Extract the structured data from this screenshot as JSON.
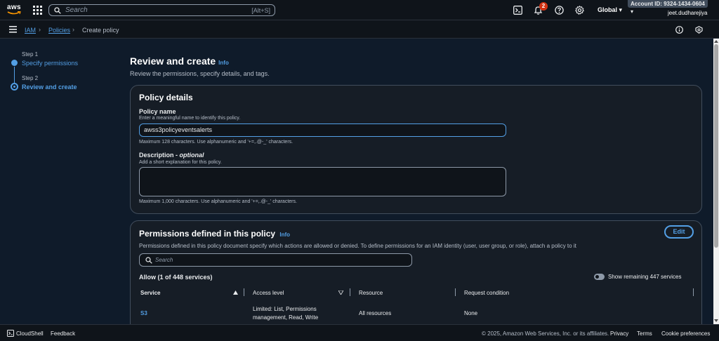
{
  "topnav": {
    "logo_text": "aws",
    "search_placeholder": "Search",
    "search_shortcut": "[Alt+S]",
    "notifications_count": "2",
    "region": "Global ▾",
    "account": "Account ID: 9324-1434-0604 ▾",
    "username": "jeet.dudharejiya"
  },
  "breadcrumb": {
    "items": [
      "IAM",
      "Policies",
      "Create policy"
    ]
  },
  "steps": [
    {
      "label": "Step 1",
      "title": "Specify permissions"
    },
    {
      "label": "Step 2",
      "title": "Review and create"
    }
  ],
  "page": {
    "title": "Review and create",
    "info": "Info",
    "subtitle": "Review the permissions, specify details, and tags."
  },
  "policy_details": {
    "title": "Policy details",
    "name_label": "Policy name",
    "name_hint": "Enter a meaningful name to identify this policy.",
    "name_value": "awss3policyeventsalerts",
    "name_constraint": "Maximum 128 characters. Use alphanumeric and '+=,.@-_' characters.",
    "desc_label": "Description - ",
    "desc_optional": "optional",
    "desc_hint": "Add a short explanation for this policy.",
    "desc_value": "",
    "desc_constraint": "Maximum 1,000 characters. Use alphanumeric and '+=,.@-_' characters."
  },
  "permissions": {
    "title": "Permissions defined in this policy",
    "info": "Info",
    "edit_label": "Edit",
    "description": "Permissions defined in this policy document specify which actions are allowed or denied. To define permissions for an IAM identity (user, user group, or role), attach a policy to it",
    "search_placeholder": "Search",
    "allow_title": "Allow (1 of 448 services)",
    "toggle_label": "Show remaining 447 services",
    "columns": [
      "Service",
      "Access level",
      "Resource",
      "Request condition"
    ],
    "rows": [
      {
        "service": "S3",
        "access_line1": "Limited: List, Permissions",
        "access_line2": "management, Read, Write",
        "resource": "All resources",
        "condition": "None"
      }
    ]
  },
  "footer": {
    "cloudshell": "CloudShell",
    "feedback": "Feedback",
    "copyright": "© 2025, Amazon Web Services, Inc. or its affiliates.",
    "privacy": "Privacy",
    "terms": "Terms",
    "cookies": "Cookie preferences"
  },
  "icons": {
    "grid": "grid-icon",
    "search": "search-icon",
    "cloudshell": "cloudshell-icon",
    "bell": "bell-icon",
    "help": "help-icon",
    "settings": "gear-icon",
    "menu": "menu-icon"
  }
}
